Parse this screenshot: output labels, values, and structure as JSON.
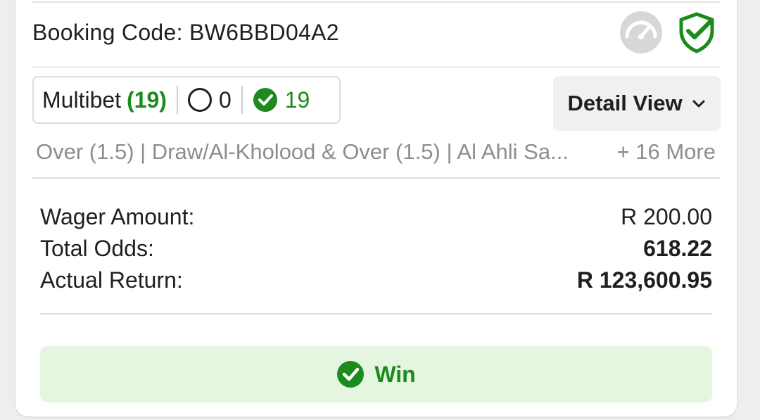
{
  "booking": {
    "label": "Booking Code:",
    "code": "BW6BBD04A2"
  },
  "icons": {
    "speed": "speedometer-icon",
    "shield": "shield-check-icon"
  },
  "multibet": {
    "label": "Multibet",
    "count": "(19)",
    "pending": "0",
    "won": "19"
  },
  "detail_button": {
    "label": "Detail View"
  },
  "selections": {
    "text": "Over (1.5) | Draw/Al-Kholood & Over (1.5) | Al Ahli Sa...",
    "more": "+ 16 More"
  },
  "summary": {
    "wager_label": "Wager Amount:",
    "wager_value": "R 200.00",
    "odds_label": "Total Odds:",
    "odds_value": "618.22",
    "return_label": "Actual Return:",
    "return_value": "R 123,600.95"
  },
  "result": {
    "label": "Win"
  },
  "colors": {
    "accent_green": "#1d8a1d",
    "win_background": "#e4f5e0"
  }
}
